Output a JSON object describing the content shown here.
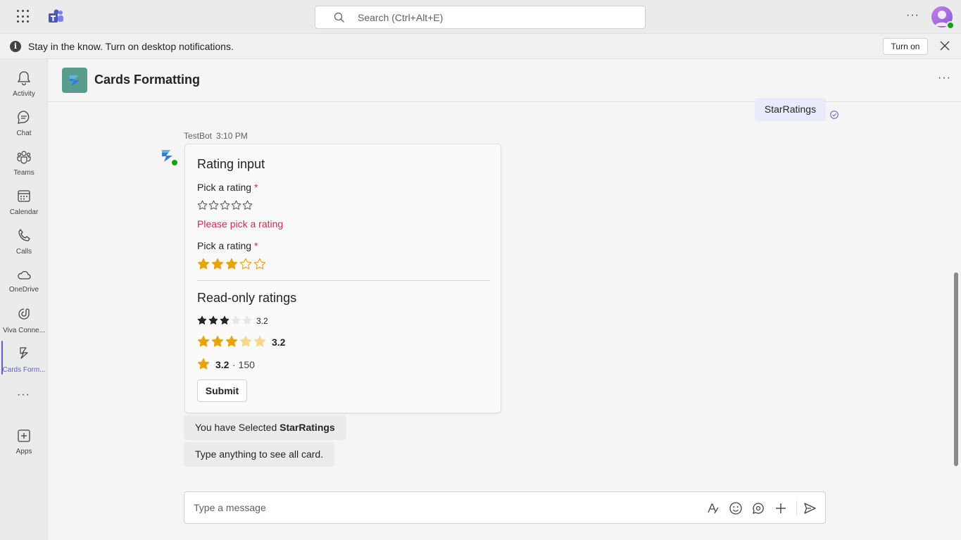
{
  "topbar": {
    "search_placeholder": "Search (Ctrl+Alt+E)",
    "more_label": "···"
  },
  "notice": {
    "text": "Stay in the know. Turn on desktop notifications.",
    "button": "Turn on",
    "info_glyph": "i"
  },
  "rail": {
    "items": [
      {
        "label": "Activity",
        "icon": "bell-icon"
      },
      {
        "label": "Chat",
        "icon": "chat-icon"
      },
      {
        "label": "Teams",
        "icon": "teams-icon"
      },
      {
        "label": "Calendar",
        "icon": "calendar-icon"
      },
      {
        "label": "Calls",
        "icon": "phone-icon"
      },
      {
        "label": "OneDrive",
        "icon": "cloud-icon"
      },
      {
        "label": "Viva Conne...",
        "icon": "viva-icon"
      },
      {
        "label": "Cards Form...",
        "icon": "cards-app-icon"
      },
      {
        "label": "Apps",
        "icon": "plus-icon"
      }
    ],
    "more_label": "···"
  },
  "header": {
    "title": "Cards Formatting",
    "more_label": "···"
  },
  "chat": {
    "sent_message": "StarRatings",
    "bot_name": "TestBot",
    "bot_time": "3:10 PM",
    "card": {
      "title": "Rating input",
      "field1_label": "Pick a rating",
      "field1_required": "*",
      "field1_value": 0,
      "field1_max": 5,
      "error": "Please pick a rating",
      "field2_label": "Pick a rating",
      "field2_required": "*",
      "field2_value": 3,
      "field2_max": 5,
      "readonly_title": "Read-only ratings",
      "ro1_value": "3.2",
      "ro2_value": "3.2",
      "ro3_value": "3.2",
      "ro3_count": "· 150",
      "submit": "Submit"
    },
    "reply1_prefix": "You have Selected ",
    "reply1_bold": "StarRatings",
    "reply2": "Type anything to see all card."
  },
  "compose": {
    "placeholder": "Type a message"
  },
  "colors": {
    "accent": "#5b5fc7",
    "star_gold": "#e8a20c",
    "star_gold_faded": "#f5d98e",
    "error": "#c4314b",
    "presence": "#13a10e"
  }
}
